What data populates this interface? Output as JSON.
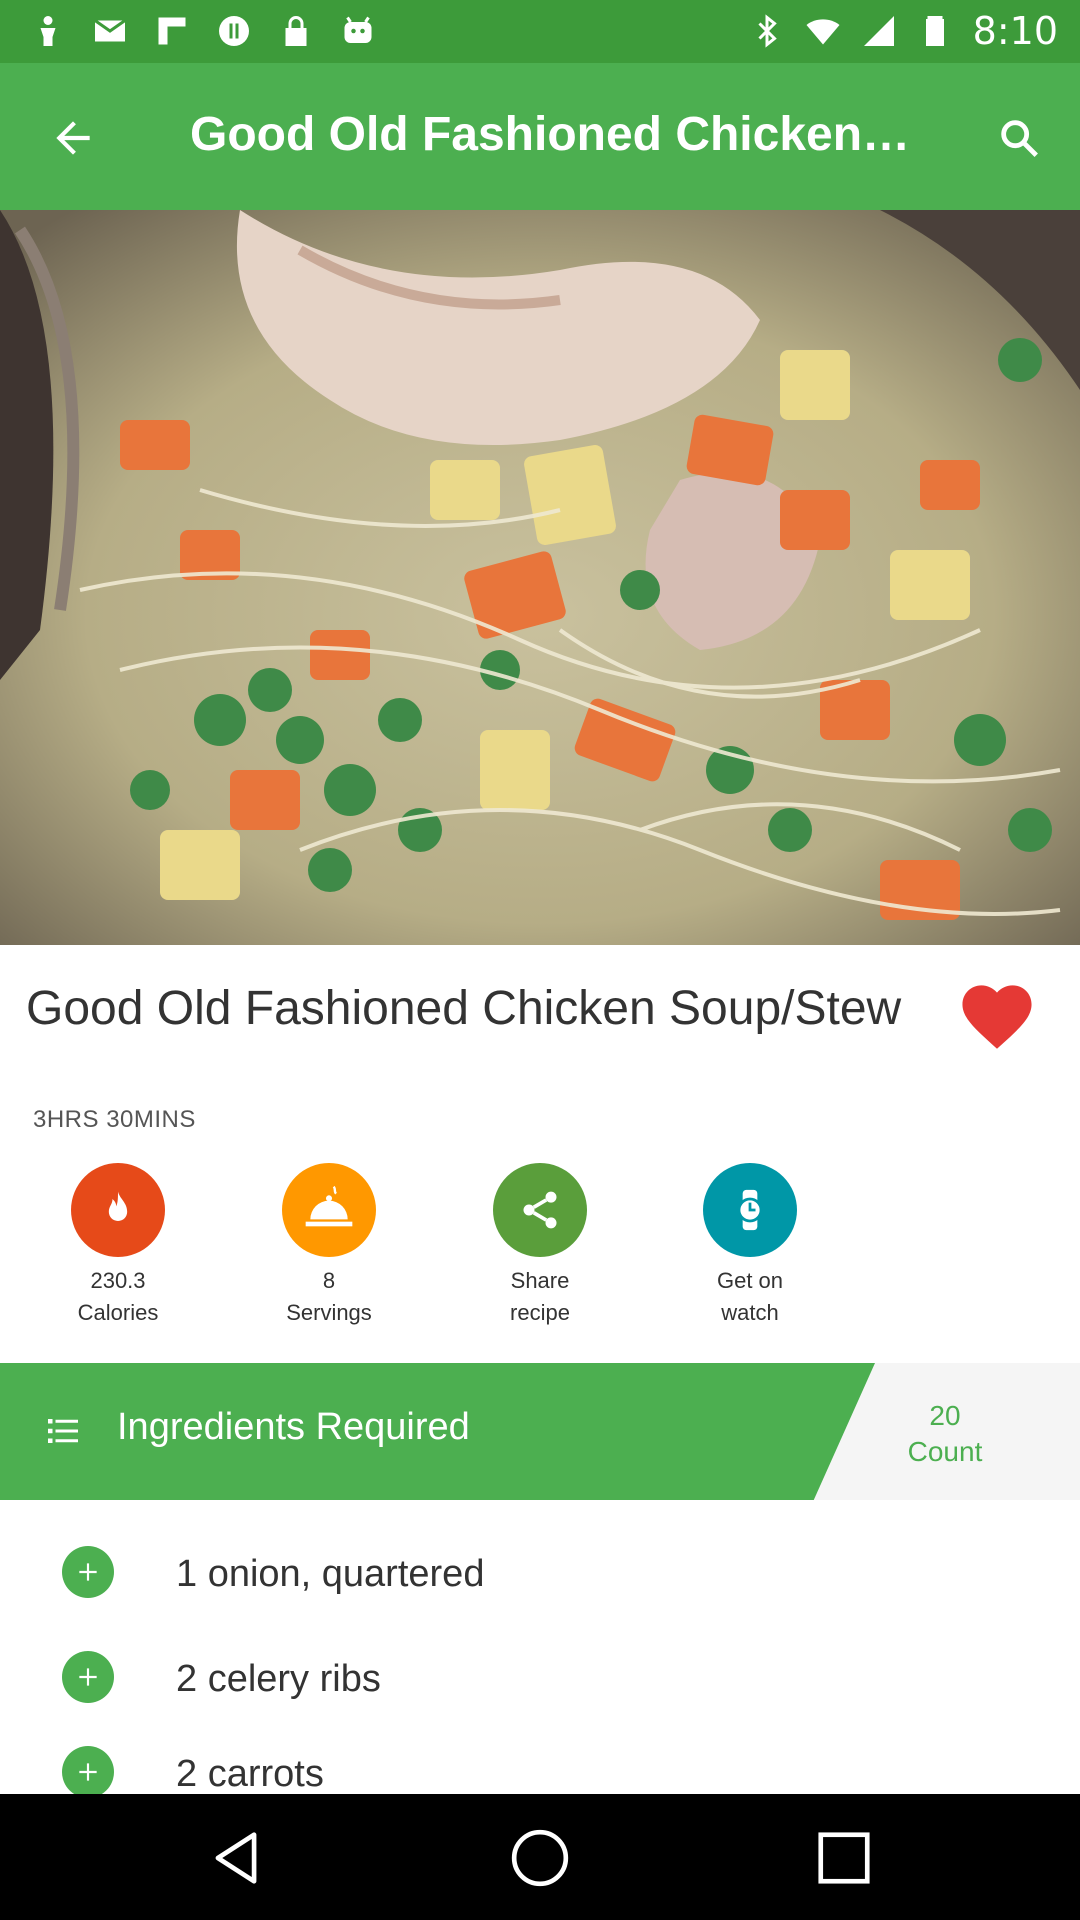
{
  "status_bar": {
    "time": "8:10",
    "left_icons": [
      "person-icon",
      "mail-icon",
      "flipboard-icon",
      "soundwave-icon",
      "lock-icon",
      "android-icon"
    ],
    "right_icons": [
      "bluetooth-icon",
      "wifi-icon",
      "signal-icon",
      "battery-icon"
    ]
  },
  "app_bar": {
    "title": "Good Old Fashioned Chicken…"
  },
  "recipe": {
    "title": "Good Old Fashioned Chicken Soup/Stew",
    "duration": "3HRS 30MINS",
    "favorite": true
  },
  "stats": [
    {
      "value": "230.3",
      "label": "Calories",
      "icon": "flame-icon",
      "color": "#e64a19"
    },
    {
      "value": "8",
      "label": "Servings",
      "icon": "cloche-icon",
      "color": "#ff9800"
    },
    {
      "value": "Share",
      "label": "recipe",
      "icon": "share-icon",
      "color": "#5a9e3b"
    },
    {
      "value": "Get on",
      "label": "watch",
      "icon": "watch-icon",
      "color": "#0097a7"
    }
  ],
  "ingredients": {
    "header": "Ingredients Required",
    "count_value": "20",
    "count_label": "Count",
    "items": [
      "1 onion, quartered",
      "2 celery ribs",
      "2 carrots"
    ]
  },
  "colors": {
    "primary": "#4caf50",
    "status_bar": "#3d9b3a",
    "favorite": "#e53935"
  }
}
